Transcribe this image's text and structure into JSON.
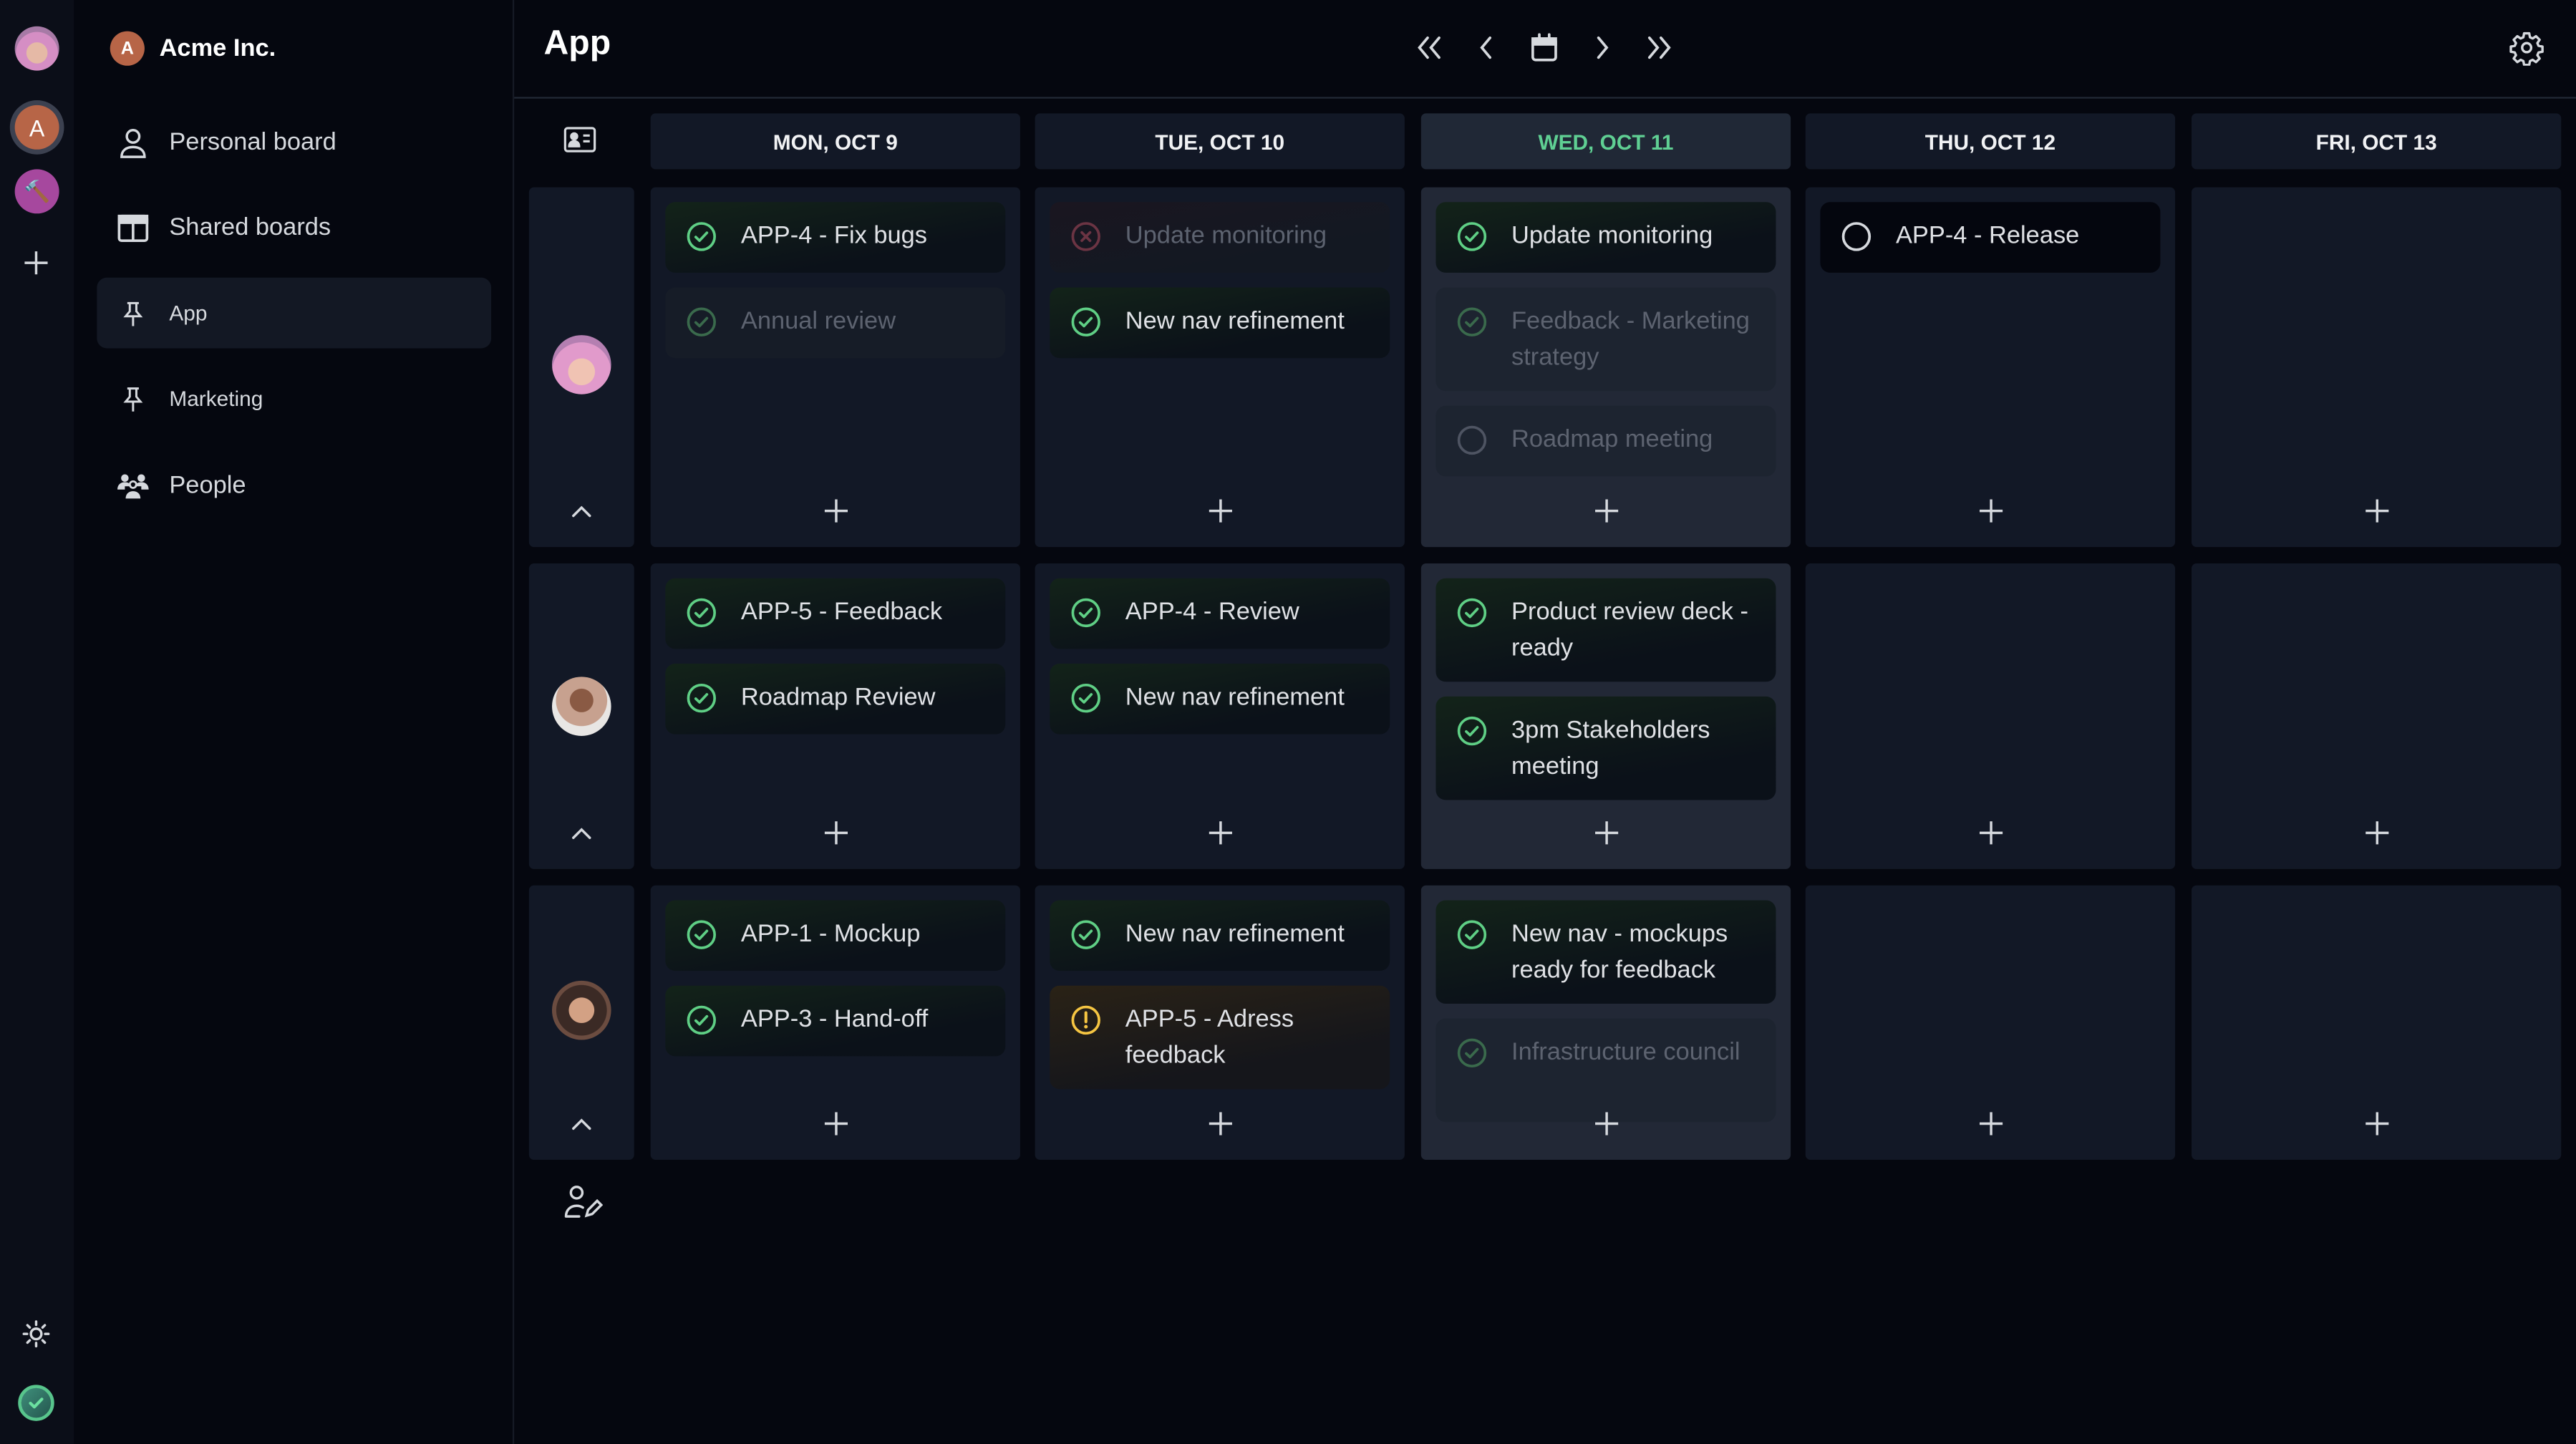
{
  "rail": {
    "workspaces": [
      {
        "name": "user-avatar",
        "initial": ""
      },
      {
        "name": "acme-workspace",
        "initial": "A"
      },
      {
        "name": "tools-workspace",
        "initial": "🔨"
      }
    ],
    "add_label": "+"
  },
  "sidebar": {
    "org_initial": "A",
    "org_name": "Acme Inc.",
    "items": [
      {
        "label": "Personal board",
        "icon": "user-icon"
      },
      {
        "label": "Shared boards",
        "icon": "columns-icon"
      },
      {
        "label": "App",
        "icon": "pin-icon",
        "active": true
      },
      {
        "label": "Marketing",
        "icon": "pin-icon"
      },
      {
        "label": "People",
        "icon": "people-icon"
      }
    ]
  },
  "header": {
    "title": "App"
  },
  "colors": {
    "accent_green": "#5fcf93",
    "warning_yellow": "#f5c542",
    "failed_red": "#7a3a4a"
  },
  "days": [
    {
      "label": "MON, OCT 9",
      "today": false
    },
    {
      "label": "TUE, OCT 10",
      "today": false
    },
    {
      "label": "WED, OCT 11",
      "today": true
    },
    {
      "label": "THU, OCT 12",
      "today": false
    },
    {
      "label": "FRI, OCT 13",
      "today": false
    }
  ],
  "rows": [
    {
      "person": "person-1",
      "cells": [
        [
          {
            "title": "APP-4 - Fix bugs",
            "status": "done"
          },
          {
            "title": "Annual review",
            "status": "done-muted"
          }
        ],
        [
          {
            "title": "Update monitoring",
            "status": "failed"
          },
          {
            "title": "New nav refinement",
            "status": "done"
          }
        ],
        [
          {
            "title": "Update monitoring",
            "status": "done"
          },
          {
            "title": "Feedback - Marketing strategy",
            "status": "done-muted"
          },
          {
            "title": "Roadmap meeting",
            "status": "open-muted"
          }
        ],
        [
          {
            "title": "APP-4 - Release",
            "status": "open"
          }
        ],
        []
      ]
    },
    {
      "person": "person-2",
      "cells": [
        [
          {
            "title": "APP-5 - Feedback",
            "status": "done"
          },
          {
            "title": "Roadmap Review",
            "status": "done"
          }
        ],
        [
          {
            "title": "APP-4 - Review",
            "status": "done"
          },
          {
            "title": "New nav refinement",
            "status": "done"
          }
        ],
        [
          {
            "title": "Product review deck - ready",
            "status": "done"
          },
          {
            "title": "3pm Stakeholders meeting",
            "status": "done"
          }
        ],
        [],
        []
      ]
    },
    {
      "person": "person-3",
      "cells": [
        [
          {
            "title": "APP-1 - Mockup",
            "status": "done"
          },
          {
            "title": "APP-3 - Hand-off",
            "status": "done"
          }
        ],
        [
          {
            "title": "New nav refinement",
            "status": "done"
          },
          {
            "title": "APP-5 - Adress feedback",
            "status": "warning"
          }
        ],
        [
          {
            "title": "New nav - mockups ready for feedback",
            "status": "done"
          },
          {
            "title": "Infrastructure council",
            "status": "done-muted"
          }
        ],
        [],
        []
      ]
    }
  ]
}
